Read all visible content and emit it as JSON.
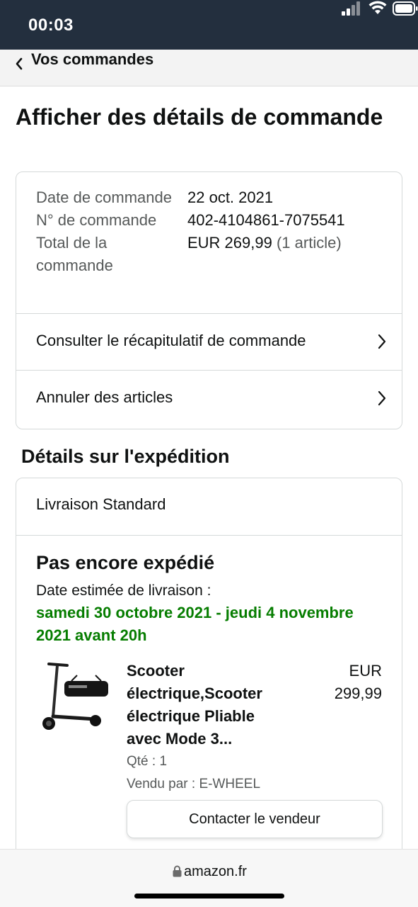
{
  "status_bar": {
    "time": "00:03"
  },
  "nav": {
    "back_label": "Vos commandes"
  },
  "page": {
    "title": "Afficher des détails de commande"
  },
  "order_summary": {
    "rows": [
      {
        "label": "Date de commande",
        "value": "22 oct. 2021"
      },
      {
        "label": "N° de commande",
        "value": "402-4104861-7075541"
      },
      {
        "label": "Total de la commande",
        "value": "EUR 269,99",
        "suffix": "(1 article)"
      }
    ],
    "links": [
      {
        "label": "Consulter le récapitulatif de commande"
      },
      {
        "label": "Annuler des articles"
      }
    ]
  },
  "shipment": {
    "section_title": "Détails sur l'expédition",
    "method": "Livraison Standard",
    "status": "Pas encore expédié",
    "delivery_label": "Date estimée de livraison :",
    "delivery_dates": "samedi 30 octobre 2021 - jeudi 4 novembre 2021 avant 20h",
    "item": {
      "title": "Scooter électrique,Scooter électrique Pliable avec Mode 3...",
      "price": "EUR 299,99",
      "quantity": "Qté : 1",
      "seller": "Vendu par : E-WHEEL",
      "contact_label": "Contacter le vendeur"
    }
  },
  "browser": {
    "url": "amazon.fr"
  },
  "colors": {
    "header_bg": "#232f3e",
    "delivery_green": "#067d00",
    "muted_text": "#565959",
    "border": "#d5d9d9"
  },
  "icons": [
    "signal-icon",
    "wifi-icon",
    "battery-icon",
    "back-chevron-icon",
    "chevron-right-icon",
    "lock-icon"
  ]
}
